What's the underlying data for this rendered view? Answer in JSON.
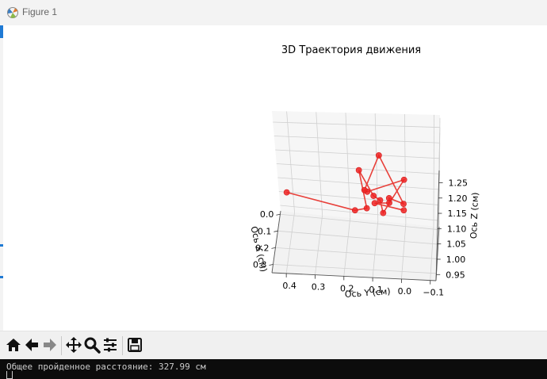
{
  "window": {
    "title": "Figure 1"
  },
  "chart_data": {
    "type": "scatter",
    "title": "3D Траектория движения",
    "xlabel": "Ось X (см)",
    "ylabel": "Ось Y (см)",
    "zlabel": "Ось Z (см)",
    "x_ticks": [
      "0.0",
      "0.1",
      "0.2",
      "0.3"
    ],
    "y_ticks": [
      "0.4",
      "0.3",
      "0.2",
      "0.1",
      "0.0",
      "−0.1"
    ],
    "z_ticks": [
      "0.95",
      "1.00",
      "1.05",
      "1.10",
      "1.15",
      "1.20",
      "1.25"
    ],
    "xlim": [
      -0.02,
      0.35
    ],
    "ylim": [
      -0.12,
      0.45
    ],
    "zlim": [
      0.93,
      1.29
    ],
    "grid": true,
    "line_color": "#e8403a",
    "point_color": "#ee2222",
    "points_note": "screen-estimated trajectory (x,y,z) in data units",
    "points": [
      [
        0.0,
        0.42,
        1.01
      ],
      [
        0.28,
        0.16,
        1.1
      ],
      [
        0.28,
        0.12,
        1.11
      ],
      [
        0.17,
        0.15,
        1.18
      ],
      [
        0.21,
        0.1,
        1.12
      ],
      [
        0.17,
        0.08,
        1.09
      ],
      [
        0.17,
        0.07,
        1.05
      ],
      [
        0.1,
        0.0,
        1.13
      ],
      [
        0.23,
        0.12,
        1.14
      ],
      [
        0.22,
        0.13,
        1.14
      ],
      [
        0.21,
        0.08,
        1.25
      ],
      [
        0.16,
        0.0,
        1.08
      ],
      [
        0.15,
        0.05,
        1.09
      ],
      [
        0.14,
        0.05,
        1.07
      ],
      [
        0.15,
        0.1,
        1.07
      ],
      [
        0.14,
        0.0,
        1.05
      ]
    ]
  },
  "toolbar": {
    "buttons": [
      "home-icon",
      "back-icon",
      "forward-icon",
      "pan-icon",
      "zoom-icon",
      "configure-subplots-icon",
      "save-icon"
    ]
  },
  "console": {
    "line": "Общее пройденное расстояние: 327.99 см"
  }
}
